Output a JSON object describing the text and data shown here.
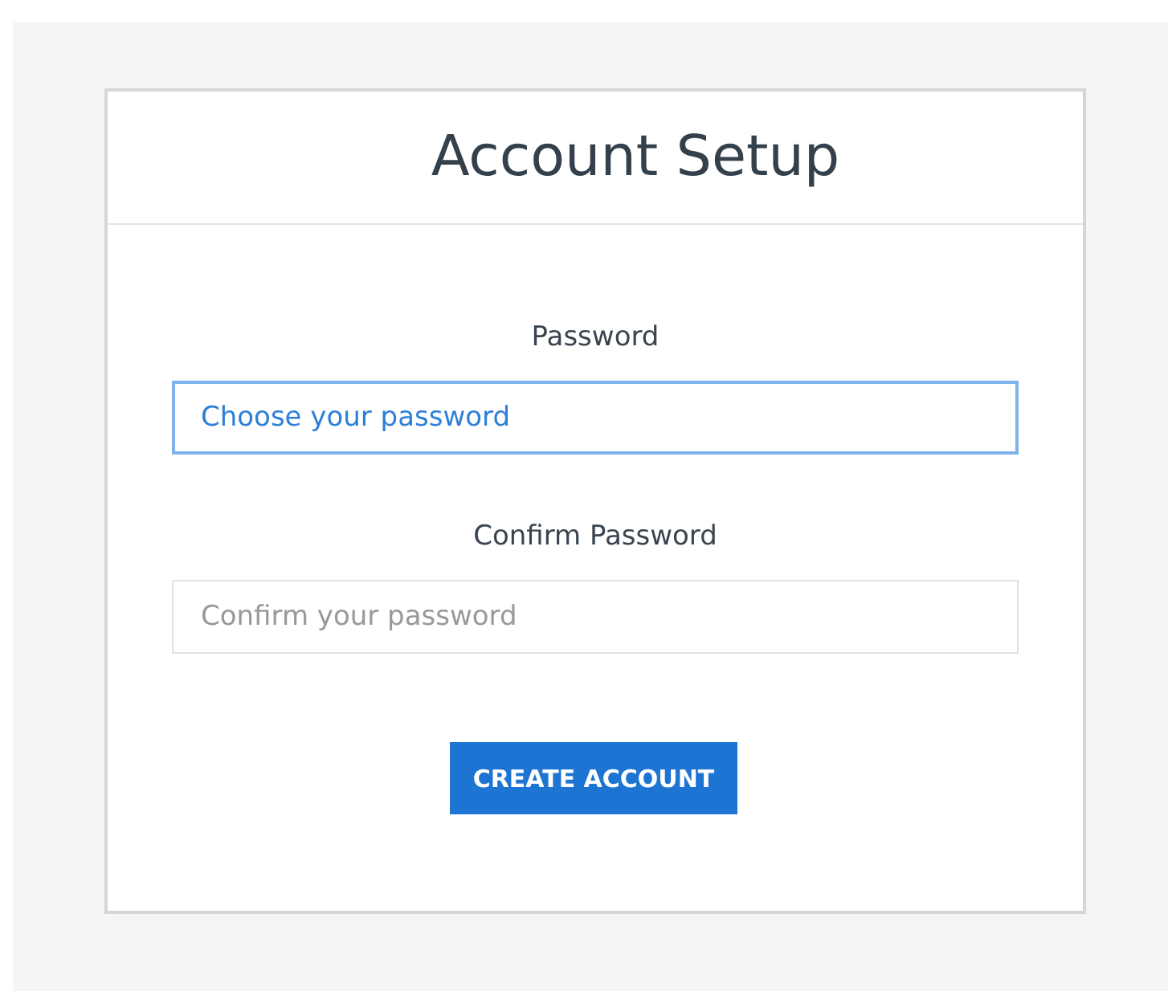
{
  "card": {
    "title": "Account Setup"
  },
  "fields": [
    {
      "label": "Password",
      "placeholder": "Choose your password",
      "focused": true
    },
    {
      "label": "Confirm Password",
      "placeholder": "Confirm your password",
      "focused": false
    }
  ],
  "button": {
    "label": "CREATE ACCOUNT"
  }
}
